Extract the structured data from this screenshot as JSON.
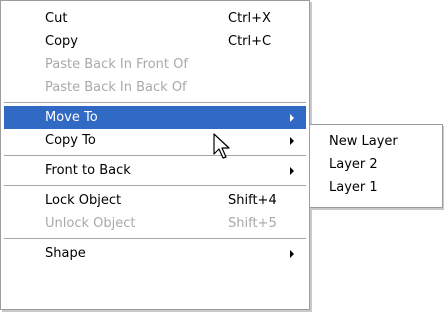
{
  "menu": {
    "items": [
      {
        "label": "Cut",
        "shortcut": "Ctrl+X",
        "disabled": false
      },
      {
        "label": "Copy",
        "shortcut": "Ctrl+C",
        "disabled": false
      },
      {
        "label": "Paste Back In Front Of",
        "shortcut": "",
        "disabled": true
      },
      {
        "label": "Paste Back In Back Of",
        "shortcut": "",
        "disabled": true
      },
      {
        "label": "Move To",
        "shortcut": "",
        "disabled": false,
        "submenu": true,
        "highlighted": true
      },
      {
        "label": "Copy To",
        "shortcut": "",
        "disabled": false,
        "submenu": true
      },
      {
        "label": "Front to Back",
        "shortcut": "",
        "disabled": false,
        "submenu": true
      },
      {
        "label": "Lock Object",
        "shortcut": "Shift+4",
        "disabled": false
      },
      {
        "label": "Unlock Object",
        "shortcut": "Shift+5",
        "disabled": true
      },
      {
        "label": "Shape",
        "shortcut": "",
        "disabled": false,
        "submenu": true
      }
    ]
  },
  "submenu": {
    "items": [
      {
        "label": "New Layer"
      },
      {
        "label": "Layer 2"
      },
      {
        "label": "Layer 1"
      }
    ]
  },
  "colors": {
    "highlight": "#316ac5",
    "disabled_text": "#a9a9a9",
    "border": "#9d9d9d"
  },
  "icons": {
    "cursor": "arrow-pointer-icon",
    "submenu_arrow": "triangle-right-icon"
  }
}
